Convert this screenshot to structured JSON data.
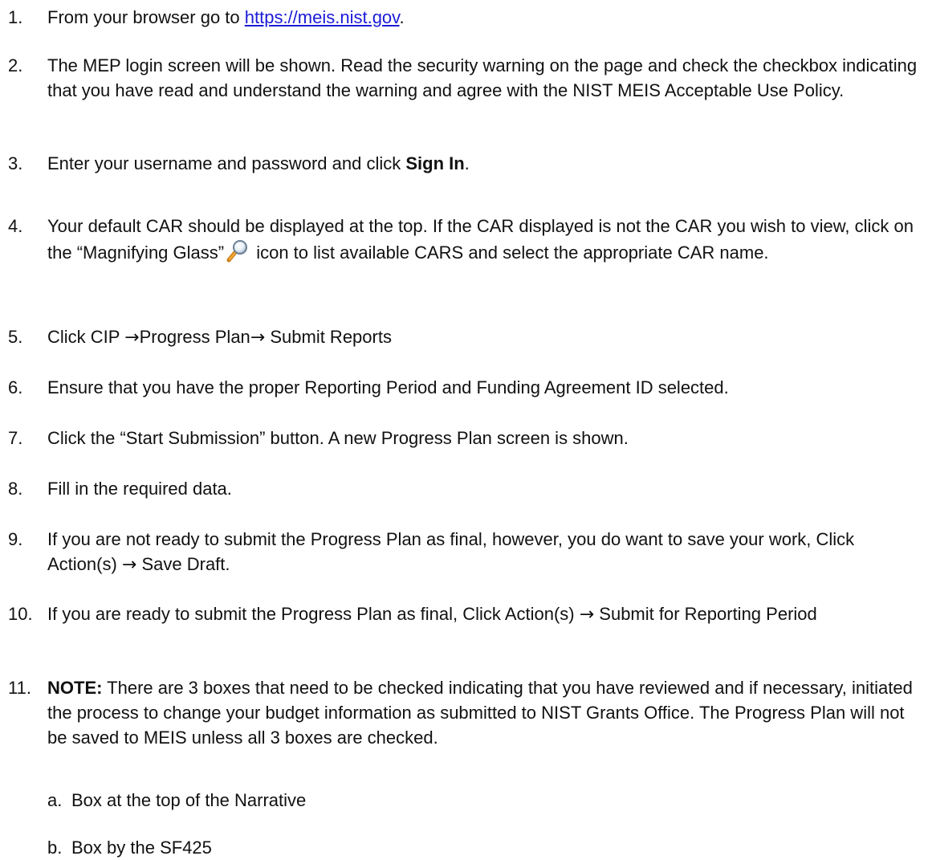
{
  "steps": [
    {
      "num": "1.",
      "pre": "From your browser go to ",
      "link": "https://meis.nist.gov",
      "post": "."
    },
    {
      "num": "2.",
      "text": "The MEP login screen will be shown. Read the security warning on the page and check the checkbox indicating that you have read and understand the warning and agree with the NIST MEIS Acceptable Use Policy."
    },
    {
      "num": "3.",
      "pre": "Enter your username and password and click ",
      "bold": "Sign In",
      "post": "."
    },
    {
      "num": "4.",
      "pre": "Your default CAR should be displayed at the top. If the CAR displayed is not the CAR you wish to view, click on the “Magnifying Glass”",
      "icon": "magnifying-glass-icon",
      "post": " icon to list available CARS and select the appropriate CAR name."
    },
    {
      "num": "5.",
      "a": "Click CIP ",
      "arrow1": "→",
      "b": "Progress Plan",
      "arrow2": "→",
      "c": " Submit Reports"
    },
    {
      "num": "6.",
      "text": "Ensure that you have the proper Reporting Period and Funding Agreement ID selected."
    },
    {
      "num": "7.",
      "text": "Click the “Start Submission” button. A new Progress Plan screen is shown."
    },
    {
      "num": "8.",
      "text": "Fill in the required data."
    },
    {
      "num": "9.",
      "pre": "If you are not ready to submit the Progress Plan as final, however, you do want to save your work, Click Action(s) ",
      "arrow": "→",
      "post": " Save Draft."
    },
    {
      "num": "10.",
      "pre": "If you are ready to submit the Progress Plan as final, Click Action(s) ",
      "arrow": "→",
      "post": " Submit for Reporting Period"
    },
    {
      "num": "11.",
      "bold": "NOTE:",
      "post": " There are 3 boxes that need to be checked indicating that you have reviewed and if necessary, initiated the process to change your budget information as submitted to NIST Grants Office. The Progress Plan will not be saved to MEIS unless all 3 boxes are checked."
    }
  ],
  "substeps": [
    {
      "num": "a.",
      "text": "Box at the top of the Narrative"
    },
    {
      "num": "b.",
      "text": "Box by the SF425"
    }
  ]
}
